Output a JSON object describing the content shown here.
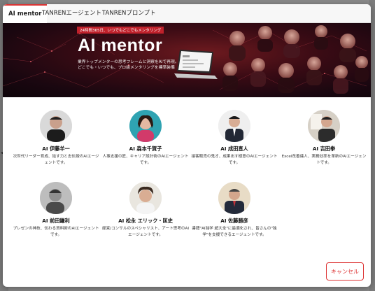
{
  "tabs": [
    {
      "label": "AI mentor",
      "active": true
    },
    {
      "label": "TANRENエージェント",
      "active": false
    },
    {
      "label": "TANRENプロンプト",
      "active": false
    }
  ],
  "banner": {
    "tag": "24時間365日、いつでもどこでもメンタリング",
    "title": "AI mentor",
    "subtitle": "業界トップメンターの思考フレームと洞察をAIで再現。どこでも・いつでも、プロ級メンタリングを標準装備"
  },
  "mentors": [
    {
      "name": "AI 伊藤羊一",
      "description": "次世代リーダー育成、話す力と志伝授のAIエージェントです。"
    },
    {
      "name": "AI 森本千賀子",
      "description": "人事支援の匠、キャリア設計術のAIエージェントです。"
    },
    {
      "name": "AI 成田直人",
      "description": "接客販売の鬼才、成果出す極意のAIエージェントです。"
    },
    {
      "name": "AI 吉田拳",
      "description": "Excel改善達人、実務効率を革新のAIエージェントです。"
    },
    {
      "name": "AI 前田鎌利",
      "description": "プレゼンの神技、伝わる資料術のAIエージェントです。"
    },
    {
      "name": "AI 松永 エリック・匡史",
      "description": "経営/コンサルのスペシャリスト、アート思考のAIエージェントです。"
    },
    {
      "name": "AI 佐藤勝彦",
      "description": "書籍\"AI独学 超大全\"に最適化され、皆さんの\"独学\"を支援できるエージェントです。"
    }
  ],
  "actions": {
    "cancel_label": "キャンセル"
  },
  "colors": {
    "accent": "#d33333",
    "banner_bg": "#2a0a12"
  }
}
